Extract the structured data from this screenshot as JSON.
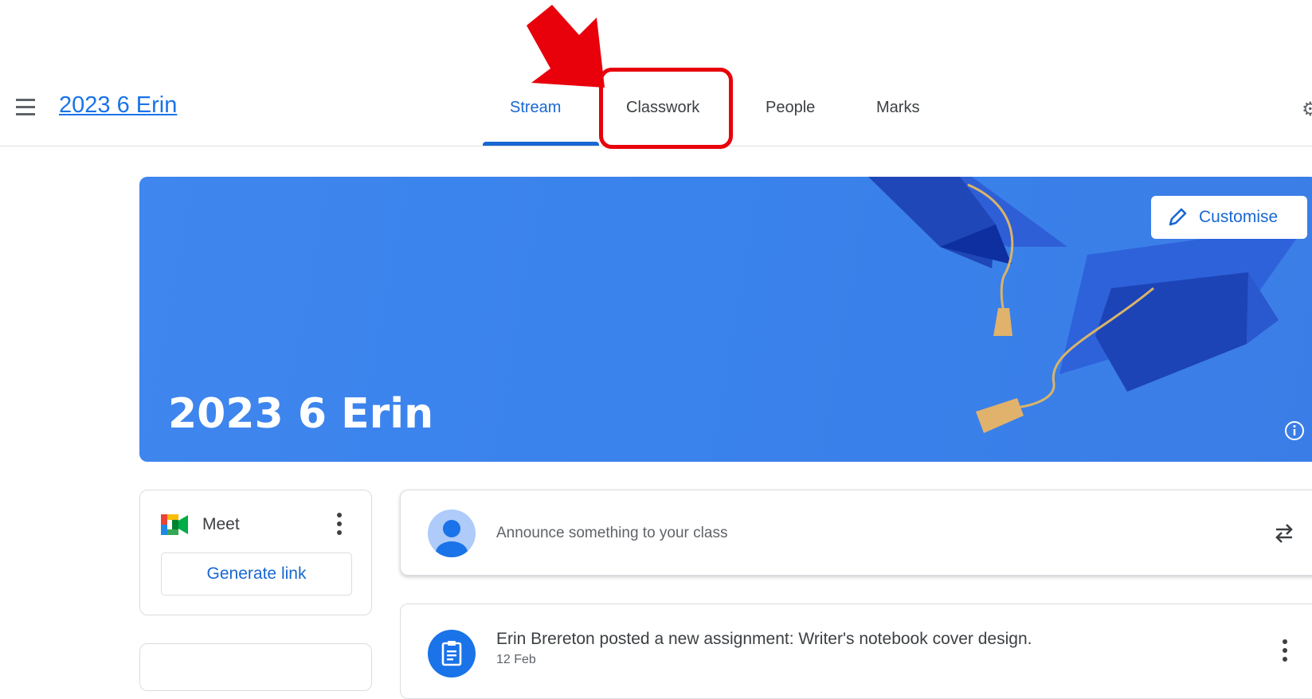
{
  "header": {
    "class_name": "2023 6 Erin",
    "tabs": [
      {
        "label": "Stream",
        "active": true
      },
      {
        "label": "Classwork",
        "active": false
      },
      {
        "label": "People",
        "active": false
      },
      {
        "label": "Marks",
        "active": false
      }
    ],
    "menu_icon": "hamburger-menu-icon",
    "settings_icon": "gear-icon"
  },
  "annotation": {
    "highlight_target": "Classwork",
    "arrow_color": "#e8000b"
  },
  "banner": {
    "title": "2023 6 Erin",
    "customise_label": "Customise",
    "background_color": "#3a82ec",
    "theme_art": "graduation-caps"
  },
  "meet": {
    "label": "Meet",
    "generate_label": "Generate link"
  },
  "announce": {
    "placeholder": "Announce something to your class"
  },
  "posts": [
    {
      "title": "Erin Brereton posted a new assignment: Writer's notebook cover design.",
      "date": "12 Feb"
    }
  ],
  "colors": {
    "accent": "#1967d2",
    "link": "#1a73e8"
  }
}
